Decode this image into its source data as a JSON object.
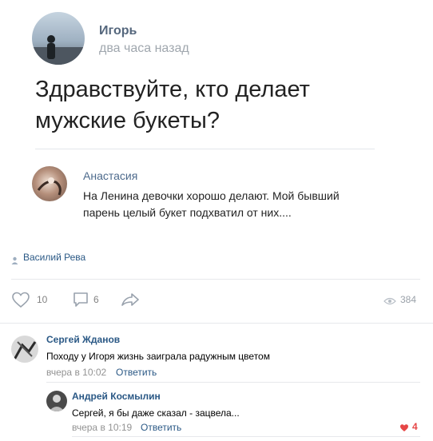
{
  "post": {
    "author": "Игорь",
    "time": "два часа назад",
    "text_line1": "Здравствуйте, кто делает",
    "text_line2": "мужские букеты?"
  },
  "reply": {
    "author": "Анастасия",
    "line1": "На Ленина девочки хорошо делают. Мой бывший",
    "line2": "парень целый букет подхватил от них...."
  },
  "credit": {
    "name": "Василий Рева"
  },
  "actions": {
    "likes": "10",
    "comments": "6",
    "views": "384"
  },
  "comments": [
    {
      "author": "Сергей Жданов",
      "text": "Походу у Игоря жизнь заиграла радужным цветом",
      "time": "вчера в 10:02",
      "reply_label": "Ответить"
    },
    {
      "author": "Андрей Космылин",
      "text": "Сергей, я бы даже сказал - зацвела...",
      "time": "вчера в 10:19",
      "reply_label": "Ответить",
      "likes": "4"
    }
  ],
  "colors": {
    "link": "#2a5885",
    "muted": "#939393",
    "heart": "#e64646",
    "divider": "#e7e8ec"
  }
}
